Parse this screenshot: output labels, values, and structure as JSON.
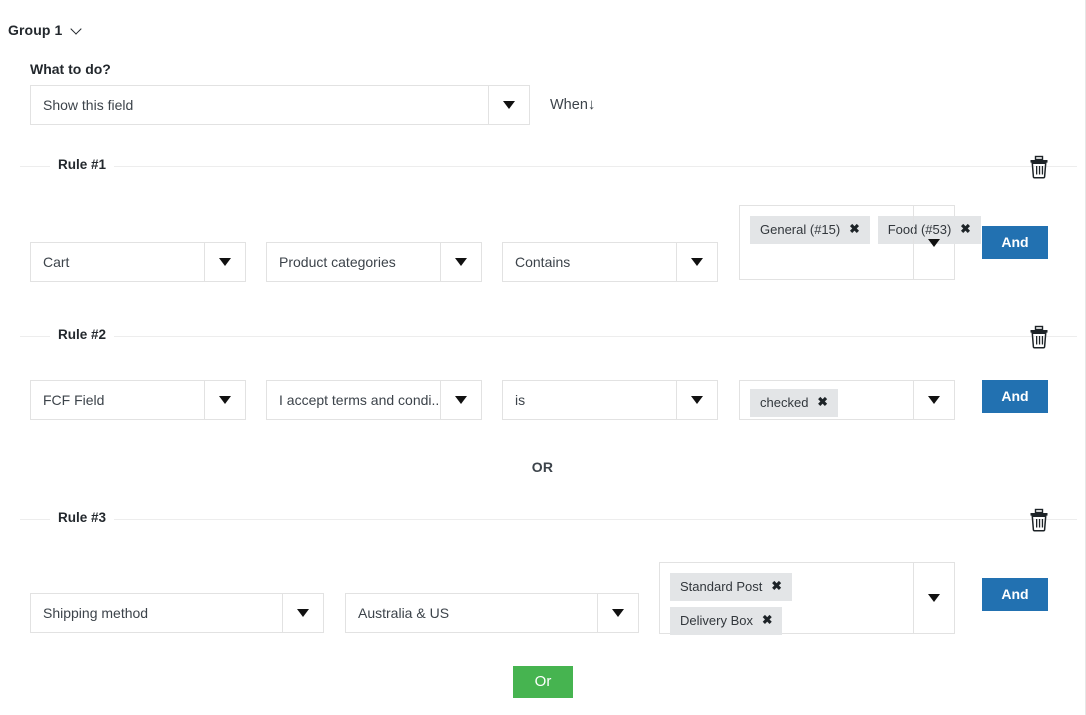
{
  "group": {
    "title": "Group 1",
    "toggle_icon": "chevron-down-icon"
  },
  "what_to_do": {
    "label": "What to do?",
    "action_value": "Show this field",
    "when_label": "When",
    "when_arrow": "↓"
  },
  "separator": {
    "or_label": "OR"
  },
  "footer": {
    "or_button_label": "Or"
  },
  "colors": {
    "and_button_bg": "#2271b1",
    "or_button_bg": "#46b450",
    "tag_bg": "#e3e5e7",
    "border": "#e2e2e2",
    "text": "#3c434a"
  },
  "rules": [
    {
      "legend": "Rule #1",
      "delete_icon": "trash-icon",
      "source": "Cart",
      "field": "Product categories",
      "operator": "Contains",
      "values": [
        "General (#15)",
        "Food (#53)"
      ],
      "connector_label": "And"
    },
    {
      "legend": "Rule #2",
      "delete_icon": "trash-icon",
      "source": "FCF Field",
      "field": "I accept terms and condi...",
      "operator": "is",
      "values": [
        "checked"
      ],
      "connector_label": "And"
    },
    {
      "legend": "Rule #3",
      "delete_icon": "trash-icon",
      "source": "Shipping method",
      "field": "Australia & US",
      "values": [
        "Standard Post",
        "Delivery Box"
      ],
      "connector_label": "And"
    }
  ]
}
